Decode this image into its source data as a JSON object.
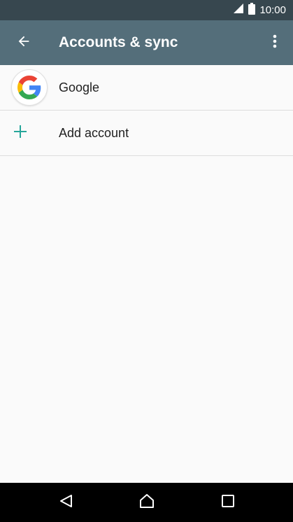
{
  "status_bar": {
    "time": "10:00",
    "icons": [
      "signal-icon",
      "battery-icon"
    ]
  },
  "app_bar": {
    "title": "Accounts & sync",
    "icons": [
      "back-arrow-icon",
      "more-vert-icon"
    ]
  },
  "accounts": {
    "items": [
      {
        "label": "Google",
        "icon": "google-icon"
      },
      {
        "label": "Add account",
        "icon": "plus-icon"
      }
    ]
  },
  "nav_bar": {
    "icons": [
      "back-icon",
      "home-icon",
      "recents-icon"
    ]
  },
  "colors": {
    "status_bar": "#37474f",
    "app_bar": "#546e7a",
    "accent": "#26a69a",
    "background": "#fafafa"
  }
}
